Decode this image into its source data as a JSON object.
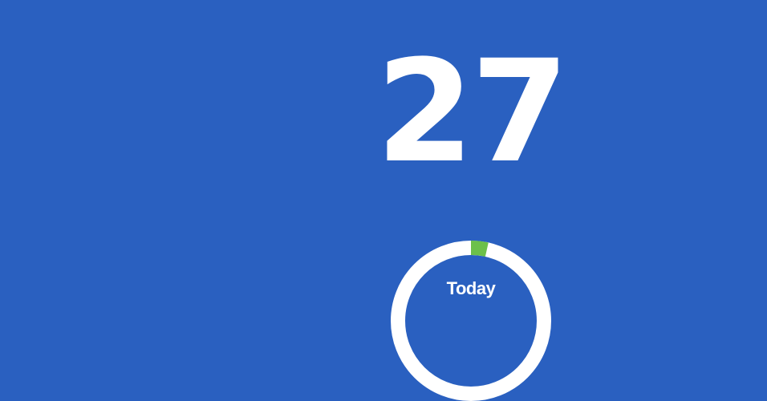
{
  "counter": {
    "value": "27"
  },
  "today_ring": {
    "label": "Today",
    "value": "",
    "progress_fraction": 0.035,
    "colors": {
      "track": "#ffffff",
      "progress": "#6cc04a",
      "background": "#2a60c0"
    }
  }
}
